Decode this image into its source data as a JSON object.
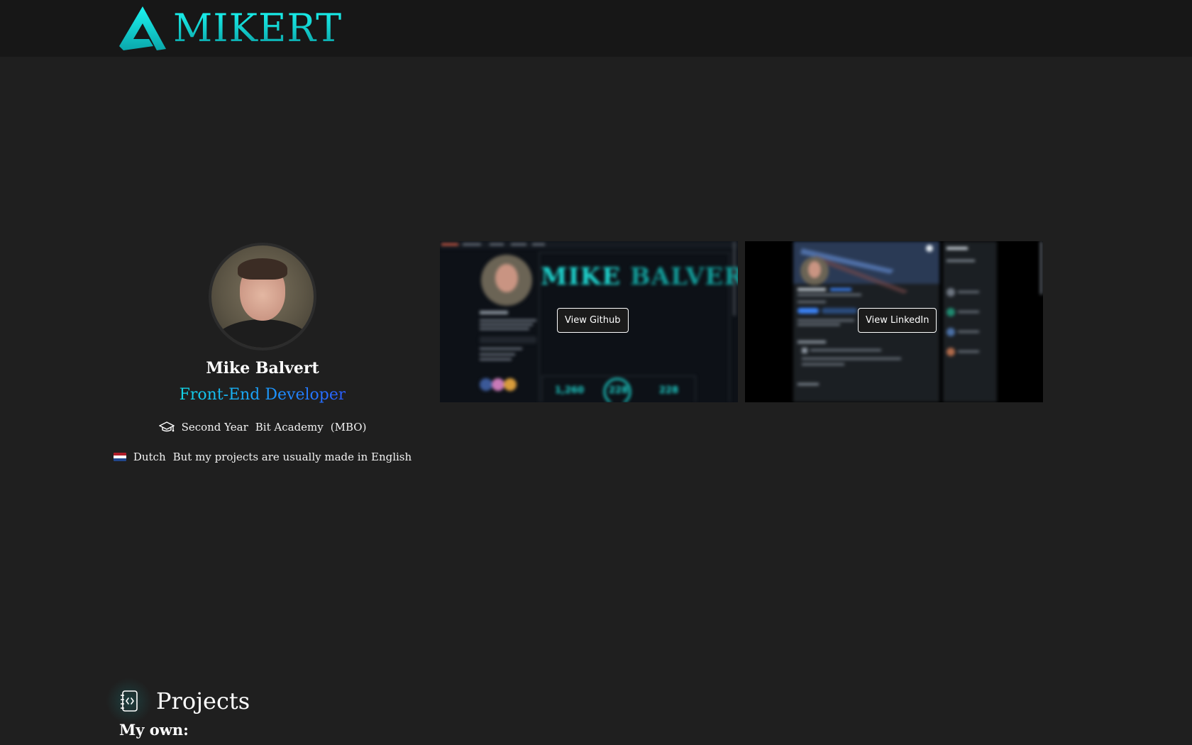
{
  "header": {
    "brand": "MIKERT",
    "logo_icon": "mikert-logo-icon",
    "accent_color": "#17d9d6"
  },
  "profile": {
    "name": "Mike Balvert",
    "role": "Front-End Developer",
    "education": {
      "icon": "graduation-cap-icon",
      "year": "Second Year",
      "school": "Bit Academy",
      "level": "(MBO)"
    },
    "language": {
      "icon": "netherlands-flag-icon",
      "name": "Dutch",
      "note": "But my projects are usually made in English"
    }
  },
  "previews": {
    "github": {
      "button": "View Github",
      "image_text": {
        "title_first": "MIKE",
        "title_last": "BALVERT",
        "stats": [
          "1,260",
          "228",
          "228"
        ]
      }
    },
    "linkedin": {
      "button": "View LinkedIn"
    }
  },
  "projects": {
    "icon": "code-notebook-icon",
    "title": "Projects",
    "subtitle": "My own:"
  }
}
